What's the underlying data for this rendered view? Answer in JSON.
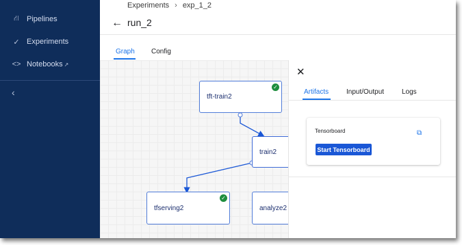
{
  "sidebar": {
    "items": [
      {
        "label": "Pipelines",
        "icon": "pipelines-icon"
      },
      {
        "label": "Experiments",
        "icon": "experiments-icon"
      },
      {
        "label": "Notebooks",
        "icon": "notebooks-icon"
      }
    ],
    "collapse_icon": "chevron-left-icon"
  },
  "breadcrumb": {
    "items": [
      "Experiments",
      "exp_1_2"
    ],
    "separator": "›"
  },
  "header": {
    "title": "run_2"
  },
  "tabs": [
    {
      "label": "Graph",
      "active": true
    },
    {
      "label": "Config",
      "active": false
    }
  ],
  "graph": {
    "nodes": [
      {
        "label": "tft-train2",
        "status": "succeeded"
      },
      {
        "label": "train2",
        "status": "selected"
      },
      {
        "label": "tfserving2",
        "status": "succeeded"
      },
      {
        "label": "analyze2",
        "status": "pending"
      }
    ]
  },
  "side_panel": {
    "tabs": [
      {
        "label": "Artifacts",
        "active": true
      },
      {
        "label": "Input/Output",
        "active": false
      },
      {
        "label": "Logs",
        "active": false
      }
    ],
    "card": {
      "title": "Tensorboard",
      "button_label": "Start Tensorboard"
    }
  },
  "colors": {
    "sidebar_bg": "#0f2d5a",
    "accent": "#1a73e8",
    "success": "#1e8e3e",
    "node_border": "#4f7bd8"
  }
}
